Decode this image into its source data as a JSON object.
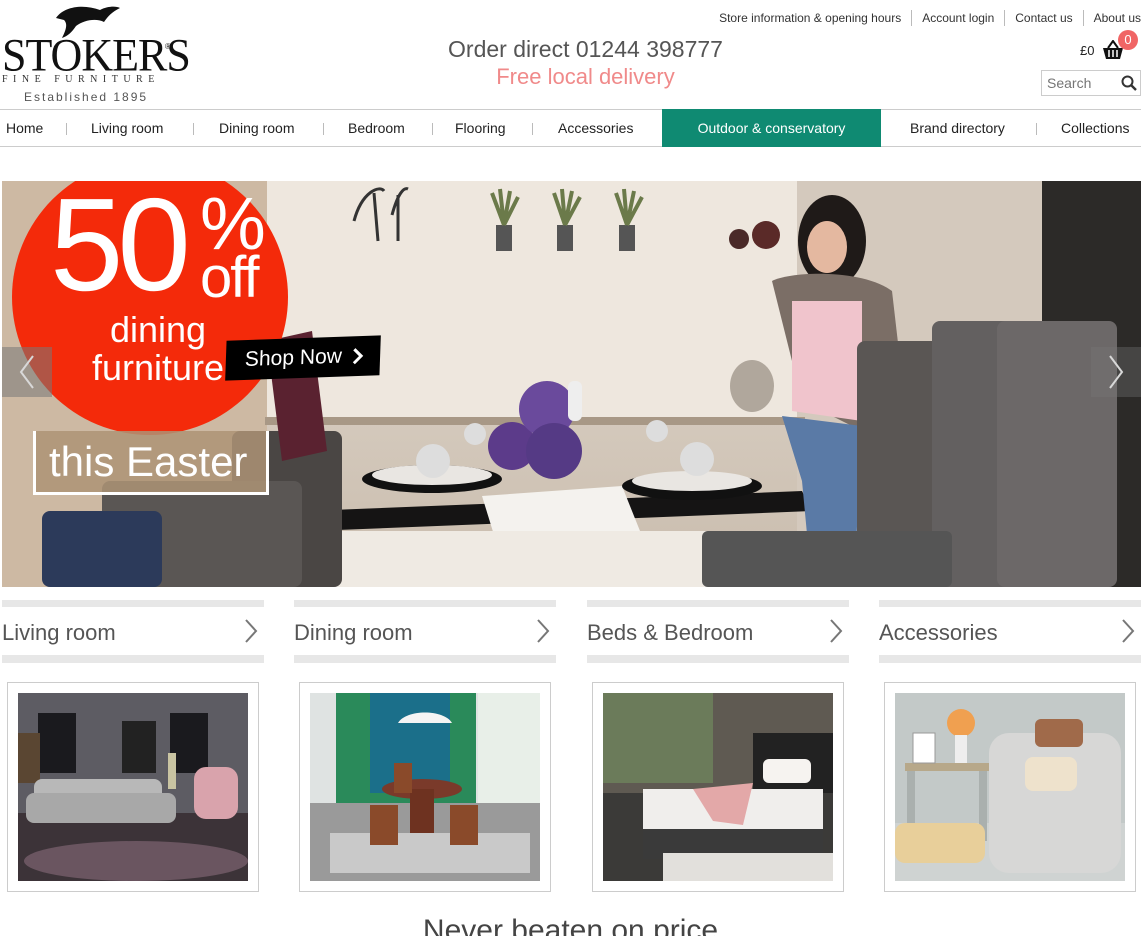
{
  "brand": {
    "name": "STOKERS",
    "registered": "®",
    "subtitle": "FINE FURNITURE",
    "established": "Established 1895"
  },
  "header": {
    "order_direct": "Order direct 01244 398777",
    "delivery": "Free local delivery",
    "top_links": [
      "Store information & opening hours",
      "Account login",
      "Contact us",
      "About us"
    ],
    "basket_amount": "£0",
    "basket_count": "0",
    "search_placeholder": "Search"
  },
  "nav": {
    "items": [
      "Home",
      "Living room",
      "Dining room",
      "Bedroom",
      "Flooring",
      "Accessories",
      "Outdoor & conservatory",
      "Brand directory",
      "Collections"
    ],
    "active": "Outdoor & conservatory"
  },
  "hero": {
    "percent": "50",
    "percent_sign": "%",
    "off": "off",
    "line1": "dining",
    "line2": "furniture",
    "easter": "this Easter",
    "shop_now": "Shop Now"
  },
  "categories": [
    {
      "label": "Living room"
    },
    {
      "label": "Dining room"
    },
    {
      "label": "Beds & Bedroom"
    },
    {
      "label": "Accessories"
    }
  ],
  "tagline": "Never beaten on price",
  "colors": {
    "accent_green": "#0f8a72",
    "promo_red": "#f42a0a",
    "delivery_pink": "#f08a8a",
    "badge": "#f06565"
  }
}
